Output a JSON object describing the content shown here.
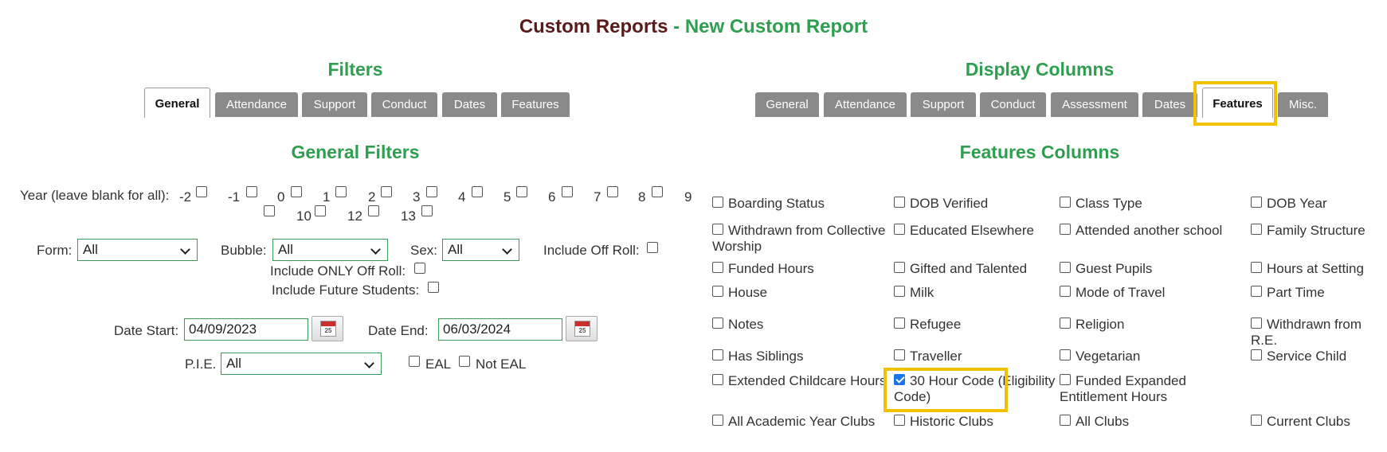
{
  "title": {
    "main": "Custom Reports",
    "sep": " - ",
    "sub": "New Custom Report"
  },
  "filters": {
    "heading": "Filters",
    "tabs": [
      "General",
      "Attendance",
      "Support",
      "Conduct",
      "Dates",
      "Features"
    ],
    "active_tab": "General",
    "general_heading": "General Filters",
    "year_label": "Year (leave blank for all):",
    "years": [
      "-2",
      "-1",
      "0",
      "1",
      "2",
      "3",
      "4",
      "5",
      "6",
      "7",
      "8",
      "9",
      "10",
      "12",
      "13"
    ],
    "form_label": "Form:",
    "form_value": "All",
    "bubble_label": "Bubble:",
    "bubble_value": "All",
    "sex_label": "Sex:",
    "sex_value": "All",
    "include_off_roll": "Include Off Roll:",
    "include_only_off_roll": "Include ONLY Off Roll:",
    "include_future": "Include Future Students:",
    "date_start_label": "Date Start:",
    "date_start_value": "04/09/2023",
    "date_end_label": "Date End:",
    "date_end_value": "06/03/2024",
    "calendar_day": "25",
    "pie_label": "P.I.E.",
    "pie_value": "All",
    "eal": "EAL",
    "not_eal": "Not EAL"
  },
  "display": {
    "heading": "Display Columns",
    "tabs": [
      "General",
      "Attendance",
      "Support",
      "Conduct",
      "Assessment",
      "Dates",
      "Features",
      "Misc."
    ],
    "active_tab": "Features",
    "features_heading": "Features Columns",
    "columns": [
      {
        "label": "Boarding Status",
        "checked": false
      },
      {
        "label": "DOB Verified",
        "checked": false
      },
      {
        "label": "Class Type",
        "checked": false
      },
      {
        "label": "DOB Year",
        "checked": false
      },
      {
        "label": "Withdrawn from Collective Worship",
        "checked": false
      },
      {
        "label": "Educated Elsewhere",
        "checked": false
      },
      {
        "label": "Attended another school",
        "checked": false
      },
      {
        "label": "Family Structure",
        "checked": false
      },
      {
        "label": "Funded Hours",
        "checked": false
      },
      {
        "label": "Gifted and Talented",
        "checked": false
      },
      {
        "label": "Guest Pupils",
        "checked": false
      },
      {
        "label": "Hours at Setting",
        "checked": false
      },
      {
        "label": "House",
        "checked": false
      },
      {
        "label": "Milk",
        "checked": false
      },
      {
        "label": "Mode of Travel",
        "checked": false
      },
      {
        "label": "Part Time",
        "checked": false
      },
      {
        "label": "Notes",
        "checked": false
      },
      {
        "label": "Refugee",
        "checked": false
      },
      {
        "label": "Religion",
        "checked": false
      },
      {
        "label": "Withdrawn from R.E.",
        "checked": false
      },
      {
        "label": "Has Siblings",
        "checked": false
      },
      {
        "label": "Traveller",
        "checked": false
      },
      {
        "label": "Vegetarian",
        "checked": false
      },
      {
        "label": "Service Child",
        "checked": false
      },
      {
        "label": "Extended Childcare Hours",
        "checked": false
      },
      {
        "label": "30 Hour Code (Eligibility Code)",
        "checked": true
      },
      {
        "label": "Funded Expanded Entitlement Hours",
        "checked": false
      },
      {
        "label": "All Academic Year Clubs",
        "checked": false
      },
      {
        "label": "Historic Clubs",
        "checked": false
      },
      {
        "label": "All Clubs",
        "checked": false
      },
      {
        "label": "Current Clubs",
        "checked": false
      }
    ]
  },
  "colors": {
    "accent_green": "#2e9e4f",
    "title_maroon": "#5a1a1a",
    "highlight": "#f2c200",
    "tab_grey": "#8a8a8a"
  }
}
